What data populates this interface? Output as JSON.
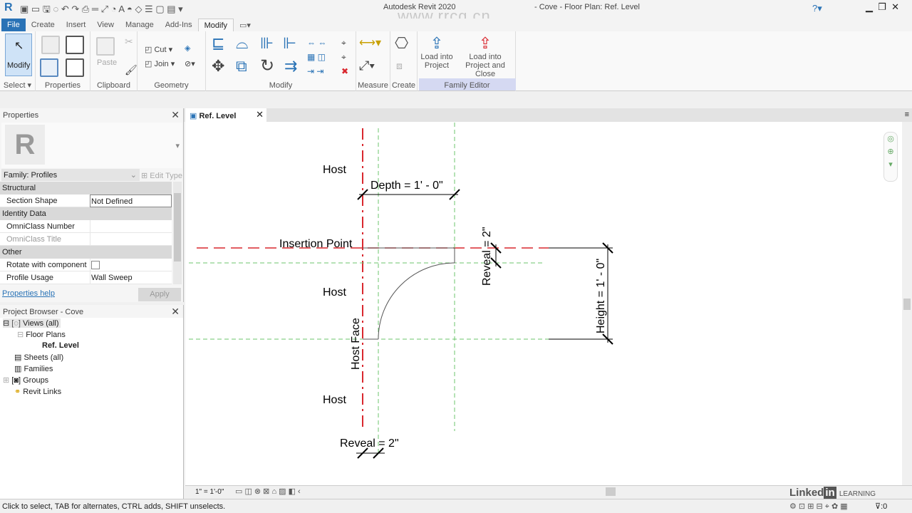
{
  "app": {
    "title": "Autodesk Revit 2020",
    "document": "- Cove - Floor Plan: Ref. Level",
    "watermark": "www.rrcg.cn"
  },
  "tabs": [
    "File",
    "Create",
    "Insert",
    "View",
    "Manage",
    "Add-Ins",
    "Modify"
  ],
  "ribbon": {
    "modify_button": "Modify",
    "panels": [
      "Select",
      "Properties",
      "Clipboard",
      "Geometry",
      "Modify",
      "Measure",
      "Create",
      "Family Editor"
    ],
    "paste": "Paste",
    "cut": "Cut",
    "join": "Join",
    "load_into_project": [
      "Load into",
      "Project"
    ],
    "load_into_project_close": [
      "Load into",
      "Project and Close"
    ]
  },
  "properties": {
    "title": "Properties",
    "family": "Family: Profiles",
    "edit_type": "Edit Type",
    "groups": [
      {
        "name": "Structural",
        "items": [
          {
            "k": "Section Shape",
            "v": "Not Defined"
          }
        ]
      },
      {
        "name": "Identity Data",
        "items": [
          {
            "k": "OmniClass Number",
            "v": ""
          },
          {
            "k": "OmniClass Title",
            "v": ""
          }
        ]
      },
      {
        "name": "Other",
        "items": [
          {
            "k": "Rotate with component",
            "v": "",
            "checkbox": false
          },
          {
            "k": "Profile Usage",
            "v": "Wall Sweep"
          }
        ]
      }
    ],
    "help": "Properties help",
    "apply": "Apply"
  },
  "browser": {
    "title": "Project Browser - Cove",
    "items": [
      "Views (all)",
      "Floor Plans",
      "Ref. Level",
      "Sheets (all)",
      "Families",
      "Groups",
      "Revit Links"
    ]
  },
  "view": {
    "tab": "Ref. Level",
    "labels": {
      "host_top": "Host",
      "host_mid": "Host",
      "host_bottom": "Host",
      "insertion": "Insertion Point",
      "host_face": "Host Face",
      "depth": "Depth = 1' - 0\"",
      "reveal_v": "Reveal = 2\"",
      "height": "Height = 1' - 0\"",
      "reveal_h": "Reveal = 2\""
    },
    "scale": "1\" = 1'-0\""
  },
  "status": {
    "hint": "Click to select, TAB for alternates, CTRL adds, SHIFT unselects.",
    "filter_count": ":0"
  },
  "branding": {
    "linkedin": "Linked",
    "in": "in",
    "learning": "LEARNING"
  },
  "colors": {
    "accent": "#2a73b6",
    "ref_red": "#d9282f",
    "ref_green": "#6cc56c",
    "family_editor": "#d5d9f2"
  }
}
